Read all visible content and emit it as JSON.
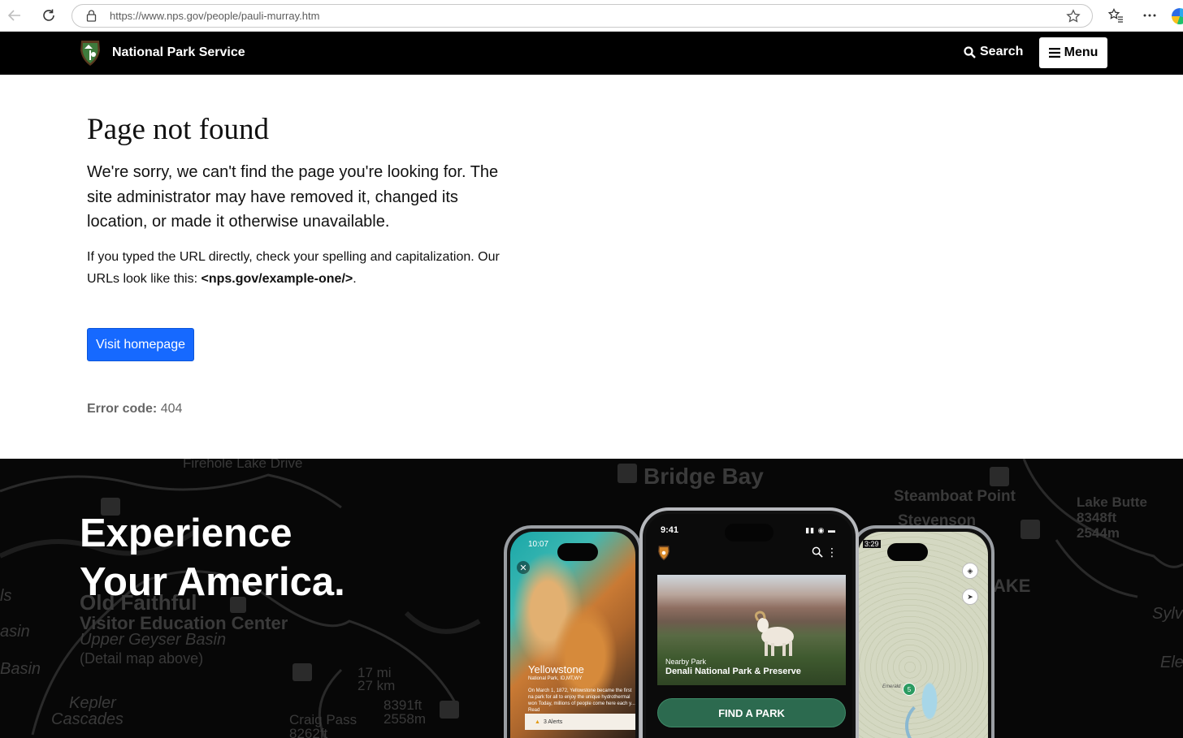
{
  "browser": {
    "url": "https://www.nps.gov/people/pauli-murray.htm"
  },
  "header": {
    "site_name": "National Park Service",
    "search_label": "Search",
    "menu_label": "Menu"
  },
  "main": {
    "title": "Page not found",
    "lead": "We're sorry, we can't find the page you're looking for. The site administrator may have removed it, changed its location, or made it otherwise unavailable.",
    "hint_prefix": "If you typed the URL directly, check your spelling and capitalization. Our URLs look like this: ",
    "hint_example": "<nps.gov/example-one/>",
    "hint_suffix": ".",
    "visit_button": "Visit homepage",
    "error_label": "Error code:",
    "error_value": "404"
  },
  "banner": {
    "headline_line1": "Experience",
    "headline_line2": "Your America.",
    "map_labels": {
      "firehole": "Firehole Lake Drive",
      "bridge_bay": "Bridge Bay",
      "steamboat": "Steamboat Point",
      "stevenson": "Stevenson",
      "lake_butte": "Lake Butte",
      "lake_butte_ft": "8348ft",
      "lake_butte_m": "2544m",
      "old_faithful": "Old Faithful",
      "visitor_center": "Visitor Education Center",
      "upper_geyser": "Upper Geyser Basin",
      "detail_map": "(Detail map above)",
      "basin1": "asin",
      "basin2": "Basin",
      "is": "ls",
      "distance_mi": "17 mi",
      "distance_km": "27 km",
      "elev_ft": "8391ft",
      "elev_m": "2558m",
      "kepler": "Kepler",
      "cascades": "Cascades",
      "craig_pass": "Craig Pass",
      "craig_ft": "8262ft",
      "ake": "AKE",
      "sylv": "Sylv",
      "ele": "Ele"
    },
    "phone_left": {
      "time": "10:07",
      "park_name": "Yellowstone",
      "park_sub": "National Park, ID,MT,WY",
      "description": "On March 1, 1872, Yellowstone became the first na park for all to enjoy the unique hydrothermal won Today, millions of people come here each y... Read",
      "alerts": "3 Alerts"
    },
    "phone_center": {
      "time": "9:41",
      "nearby_label": "Nearby Park",
      "park_name": "Denali National Park & Preserve",
      "find_button": "FIND A PARK"
    },
    "phone_right": {
      "time": "3:29",
      "pin_number": "5",
      "lake_label": "Emerald"
    }
  },
  "colors": {
    "header_bg": "#000000",
    "primary_button": "#1669ff",
    "find_park_button": "#2c6a4f"
  }
}
